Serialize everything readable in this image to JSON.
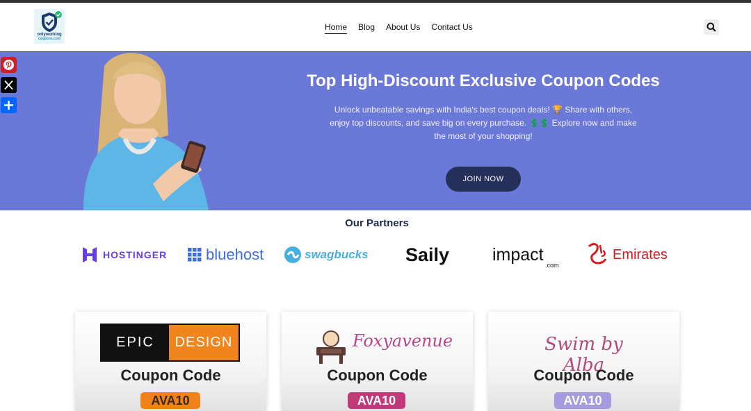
{
  "header": {
    "logo": {
      "text_line1": "onlyworking",
      "text_line2": "coupons.com",
      "icon": "shield-check-icon"
    },
    "nav": [
      "Home",
      "Blog",
      "About Us",
      "Contact Us"
    ],
    "search_icon": "search-icon"
  },
  "share": {
    "pinterest_icon": "pinterest-icon",
    "x_icon": "x-icon",
    "add_icon": "plus-icon"
  },
  "hero": {
    "title": "Top High-Discount Exclusive Coupon Codes",
    "subtitle": "Unlock unbeatable savings with India's best coupon deals! 🏆 Share with others, enjoy top discounts, and save big on every purchase. 💲💲 Explore now and make the most of your shopping!",
    "cta": "JOIN NOW",
    "background": "#6a78d8"
  },
  "partners": {
    "title": "Our Partners",
    "logos": [
      "HOSTINGER",
      "bluehost",
      "swagbucks",
      "Saily",
      "impact",
      ".com",
      "Emirates"
    ]
  },
  "cards": [
    {
      "brand_left": "EPIC",
      "brand_right": "DESIGN",
      "label": "Coupon Code",
      "code": "AVA10"
    },
    {
      "brand": "Foxyavenue",
      "label": "Coupon Code",
      "code": "AVA10"
    },
    {
      "brand": "Swim by Alba",
      "label": "Coupon Code",
      "code": "AVA10"
    }
  ]
}
